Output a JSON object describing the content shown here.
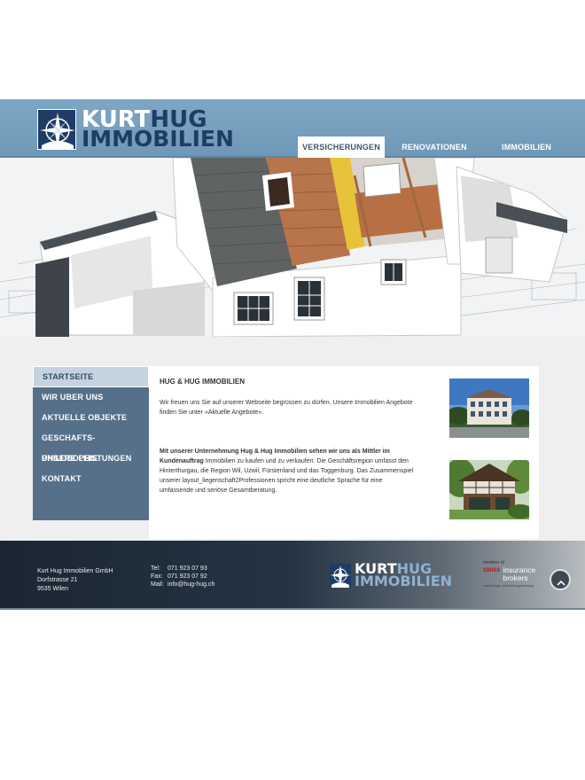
{
  "brand": {
    "logo_word1": "KURT",
    "logo_word2": "HUG",
    "logo_word3": "IMMOBILIEN",
    "colors": {
      "header": "#7fa6c4",
      "navy": "#1e3c66",
      "sidenav": "#56708a",
      "footer": "#1b2632"
    }
  },
  "topnav": {
    "items": [
      {
        "label": "VERSICHERUNGEN",
        "active": true
      },
      {
        "label": "RENOVATIONEN",
        "active": false
      },
      {
        "label": "IMMOBILIEN",
        "active": false
      }
    ]
  },
  "sidenav": {
    "items": [
      {
        "label": "STARTSEITE",
        "active": true
      },
      {
        "label": "WIR UBER UNS",
        "active": false
      },
      {
        "label": "AKTUELLE OBJEKTE",
        "active": false
      },
      {
        "label": "GESCHAFTS-PHILOSOPHIE",
        "active": false
      },
      {
        "label": "UNSERE LEISTUNGEN",
        "active": false
      },
      {
        "label": "KONTAKT",
        "active": false
      }
    ]
  },
  "content": {
    "title": "HUG & HUG IMMOBILIEN",
    "paragraph1": "Wir freuen uns Sie auf unserer Webseite begrüssen zu dürfen. Unsere Immobilien Angebote finden Sie unter «Aktuelle Angebote».",
    "paragraph2_bold": "Mit unserer Unternehmung Hug & Hug Immobilien sehen wir uns als Mittler im Kundenauftrag",
    "paragraph2_rest": " Immobilien zu kaufen und zu verkaufen. Die Geschäftsregion umfasst den Hinterthurgau, die Region Wil, Uzwil, Fürstenland und das Toggenburg. Das Zusammenspiel unserer layout_liegenschaft2Professionen spricht eine deutliche Sprache für eine umfassende und seriöse Gesamtberatung."
  },
  "footer": {
    "company": "Kurt Hug Immobilien GmbH",
    "street": "Dorfstrasse 21",
    "city": "9535 Wilen",
    "tel_label": "Tel:",
    "tel": "071 923 07 93",
    "fax_label": "Fax:",
    "fax": "071 923 07 92",
    "mail_label": "Mail:",
    "mail": "info@hug-hug.ch",
    "member_of": "member of",
    "sib_swiss": "SWISS",
    "sib_word1": "insurance",
    "sib_word2": "brokers",
    "sib_tagline": "unabhängige versicherungsberatung"
  },
  "icons": {
    "logo": "compass-star-icon",
    "back_to_top": "chevron-up-icon"
  }
}
